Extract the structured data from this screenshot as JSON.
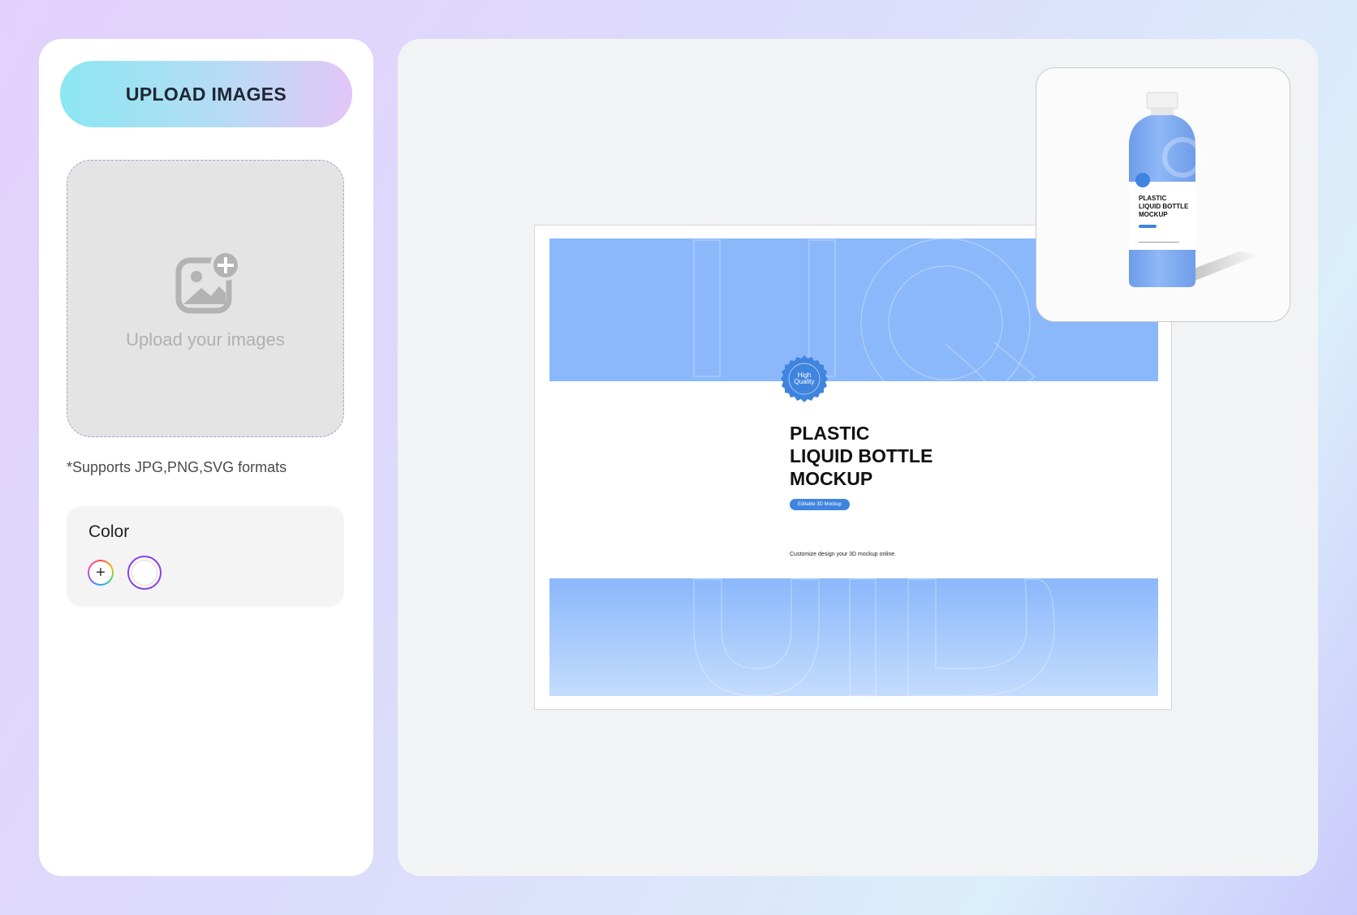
{
  "sidebar": {
    "upload_button_label": "UPLOAD IMAGES",
    "dropzone_text": "Upload your images",
    "formats_note": "*Supports JPG,PNG,SVG formats",
    "color_section": {
      "label": "Color",
      "add_glyph": "+",
      "selected_color": "#ffffff"
    }
  },
  "canvas": {
    "label_design": {
      "seal_text": "High\nQuality",
      "title_lines": [
        "PLASTIC",
        "LIQUID BOTTLE",
        "MOCKUP"
      ],
      "badge": "Editable 3D Mockup",
      "caption": "Customize design your 3D mockup online.",
      "background_letters_top": "LIQ",
      "background_letters_bottom": "UID",
      "primary_color": "#8ab8fb",
      "accent_color": "#3f84de"
    },
    "preview": {
      "title_lines": "PLASTIC\nLIQUID BOTTLE\nMOCKUP"
    }
  }
}
